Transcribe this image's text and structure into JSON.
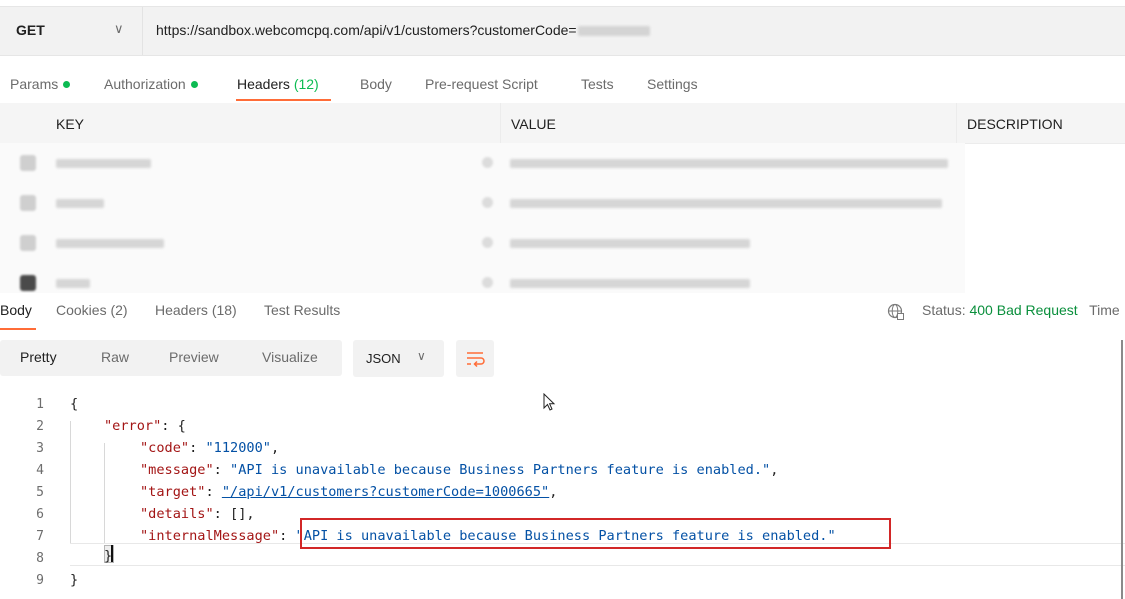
{
  "request": {
    "method": "GET",
    "url": "https://sandbox.webcomcpq.com/api/v1/customers?customerCode="
  },
  "request_tabs": [
    {
      "label": "Params",
      "dot": true
    },
    {
      "label": "Authorization",
      "dot": true
    },
    {
      "label": "Headers",
      "count": "(12)",
      "active": true
    },
    {
      "label": "Body"
    },
    {
      "label": "Pre-request Script"
    },
    {
      "label": "Tests"
    },
    {
      "label": "Settings"
    }
  ],
  "headers_table": {
    "columns": [
      "KEY",
      "VALUE",
      "DESCRIPTION"
    ]
  },
  "response_tabs": [
    {
      "label": "Body",
      "active": true
    },
    {
      "label": "Cookies",
      "count": "(2)"
    },
    {
      "label": "Headers",
      "count": "(18)"
    },
    {
      "label": "Test Results"
    }
  ],
  "status": {
    "label": "Status:",
    "value": "400 Bad Request",
    "extra": "Time"
  },
  "view_modes": [
    "Pretty",
    "Raw",
    "Preview",
    "Visualize"
  ],
  "format": "JSON",
  "code": {
    "line_numbers": [
      "1",
      "2",
      "3",
      "4",
      "5",
      "6",
      "7",
      "8",
      "9"
    ],
    "open_brace": "{",
    "close_brace": "}",
    "error_key": "\"error\"",
    "code_key": "\"code\"",
    "code_val": "\"112000\"",
    "message_key": "\"message\"",
    "message_val": "\"API is unavailable because Business Partners feature is enabled.\"",
    "target_key": "\"target\"",
    "target_val": "\"/api/v1/customers?customerCode=1000665\"",
    "details_key": "\"details\"",
    "details_val": "[]",
    "internal_key": "\"internalMessage\"",
    "internal_val": "\"API is unavailable because Business Partners feature is enabled.\""
  },
  "colors": {
    "accent": "#ff6c37",
    "success_dot": "#0cbb52",
    "status_error_text": "#0a8f3c",
    "highlight_box": "#d22727"
  },
  "icons": [
    "chevron-down-icon",
    "globe-icon",
    "wrap-lines-icon",
    "mouse-pointer-icon"
  ]
}
